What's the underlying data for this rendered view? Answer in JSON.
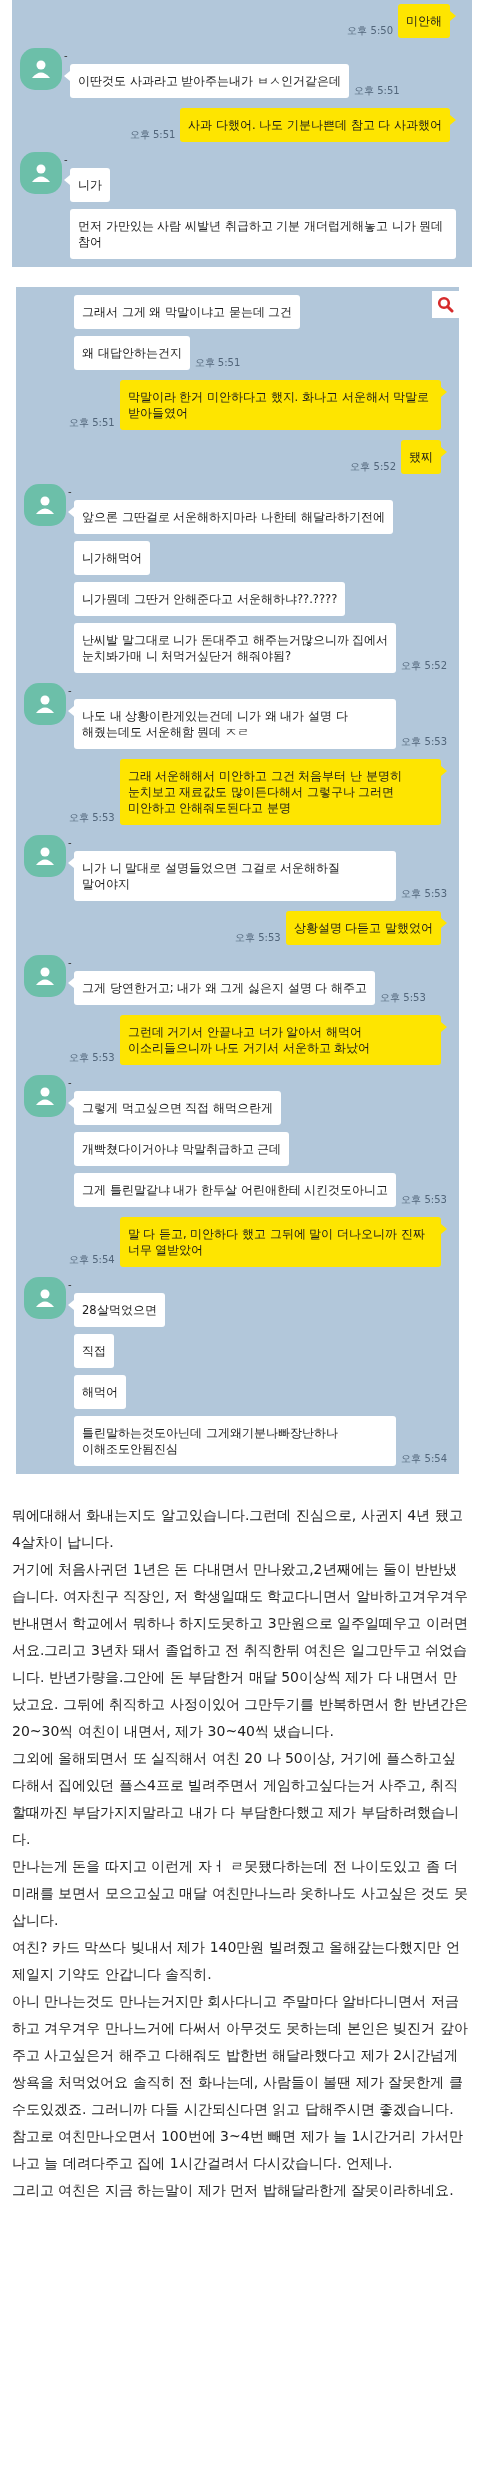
{
  "panels": [
    {
      "has_search": false,
      "messages": [
        {
          "kind": "sent",
          "text": "미안해",
          "time": "오후 5:50"
        },
        {
          "kind": "received",
          "sender": "-",
          "bubbles": [
            "이딴것도 사과라고 받아주는내가 ㅂㅅ인거같은데"
          ],
          "time": "오후 5:51"
        },
        {
          "kind": "sent",
          "text": "사과 다했어. 나도 기분나쁜데 참고 다 사과했어",
          "time": "오후 5:51"
        },
        {
          "kind": "received",
          "sender": "-",
          "bubbles": [
            "니가",
            "먼저 가만있는 사람 씨발년 취급하고 기분 개더럽게해놓고 니가 뭔데 참어"
          ]
        }
      ]
    },
    {
      "has_search": true,
      "messages": [
        {
          "kind": "received",
          "bubbles": [
            "그래서 그게 왜 막말이냐고 묻는데 그건",
            "왜 대답안하는건지"
          ],
          "time": "오후 5:51"
        },
        {
          "kind": "sent",
          "text": "막말이라 한거 미안하다고 했지. 화나고 서운해서 막말로 받아들였어",
          "time": "오후 5:51"
        },
        {
          "kind": "sent",
          "text": "됐찌",
          "time": "오후 5:52"
        },
        {
          "kind": "received",
          "sender": "-",
          "bubbles": [
            "앞으론 그딴걸로 서운해하지마라 나한테 해달라하기전에",
            "니가해먹어",
            "니가뭔데 그딴거 안해준다고 서운해하냐??.????",
            "난씨발 말그대로 니가 돈대주고 해주는거많으니까 집에서 눈치봐가매 니 처먹거싶단거 해줘야됨?"
          ],
          "time": "오후 5:52"
        },
        {
          "kind": "received",
          "sender": "-",
          "bubbles": [
            "나도 내 상황이란게있는건데 니가 왜 내가 설명 다 해줬는데도 서운해함 뭔데 ㅈㄹ"
          ],
          "time": "오후 5:53"
        },
        {
          "kind": "sent",
          "text": "그래 서운해해서 미안하고 그건 처음부터 난 분명히 눈치보고 재료값도 많이든다해서 그렇구나 그러면 미안하고 안해줘도된다고 분명",
          "time": "오후 5:53"
        },
        {
          "kind": "received",
          "sender": "-",
          "bubbles": [
            "니가 니 말대로 설명들었으면 그걸로 서운해하질 말어야지"
          ],
          "time": "오후 5:53"
        },
        {
          "kind": "sent",
          "text": "상황설명 다듣고 말했었어",
          "time": "오후 5:53"
        },
        {
          "kind": "received",
          "sender": "-",
          "bubbles": [
            "그게 당연한거고; 내가 왜 그게 싫은지 설명 다 해주고"
          ],
          "time": "오후 5:53"
        },
        {
          "kind": "sent",
          "text": "그런데 거기서 안끝나고 너가 알아서 해먹어 이소리들으니까 나도 거기서 서운하고 화났어",
          "time": "오후 5:53"
        },
        {
          "kind": "received",
          "sender": "-",
          "bubbles": [
            "그렇게 먹고싶으면 직접 해먹으란게",
            "개빡쳤다이거아냐 막말취급하고 근데",
            "그게 틀린말같냐 내가 한두살 어린애한테 시킨것도아니고"
          ],
          "time": "오후 5:53"
        },
        {
          "kind": "sent",
          "text": "말 다 듣고, 미안하다 했고 그뒤에 말이 더나오니까 진짜 너무 열받았어",
          "time": "오후 5:54"
        },
        {
          "kind": "received",
          "sender": "-",
          "bubbles": [
            "28살먹었으면",
            "직접",
            "해먹어",
            "틀린말하는것도아닌데 그게왜기분나빠장난하나 이해조도안됨진심"
          ],
          "time": "오후 5:54"
        }
      ]
    }
  ],
  "article": {
    "paragraphs": [
      "뭐에대해서 화내는지도 알고있습니다.그런데 진심으로, 사귄지 4년 됐고 4살차이 납니다.",
      "거기에 처음사귀던 1년은 돈 다내면서 만나왔고,2년째에는 둘이 반반냈습니다. 여자친구 직장인, 저 학생일때도 학교다니면서 알바하고겨우겨우 반내면서 학교에서 뭐하나 하지도못하고 3만원으로 일주일떼우고 이러면서요.그리고 3년차 돼서 졸업하고 전 취직한뒤 여친은 일그만두고 쉬었습니다. 반년가량을.그안에 돈 부담한거 매달 50이상씩 제가 다 내면서 만났고요. 그뒤에 취직하고 사정이있어 그만두기를 반복하면서 한 반년간은 20~30씩 여친이 내면서, 제가 30~40씩 냈습니다.",
      "그외에 올해되면서 또 실직해서 여친 20 나 50이상, 거기에 플스하고싶다해서 집에있던 플스4프로 빌려주면서 게임하고싶다는거 사주고, 취직할때까진 부담가지지말라고 내가 다 부담한다했고 제가 부담하려했습니다.",
      "만나는게 돈을 따지고 이런게 자ㅓ ㄹ못됐다하는데 전 나이도있고 좀 더 미래를 보면서 모으고싶고 매달 여친만나느라 옷하나도 사고싶은 것도 못삽니다.",
      "여친? 카드 막쓰다 빚내서 제가 140만원 빌려줬고 올해갚는다했지만 언제일지 기약도 안갑니다 솔직히.",
      "아니 만나는것도 만나는거지만 회사다니고 주말마다 알바다니면서 저금하고 겨우겨우 만나느거에 다써서 아무것도 못하는데 본인은 빚진거 갚아주고 사고싶은거 해주고 다해줘도 밥한번 해달라했다고 제가 2시간넘게 쌍욕을 처먹었어요 솔직히 전 화나는데, 사람들이 볼땐 제가 잘못한게 클수도있겠죠. 그러니까 다들 시간되신다면 읽고 답해주시면 좋겠습니다.",
      "참고로 여친만나오면서 100번에 3~4번 빼면 제가 늘 1시간거리 가서만나고 늘 데려다주고 집에 1시간걸려서 다시갔습니다. 언제나.",
      "그리고 여친은 지금 하는말이 제가 먼저 밥해달라한게 잘못이라하네요."
    ]
  }
}
